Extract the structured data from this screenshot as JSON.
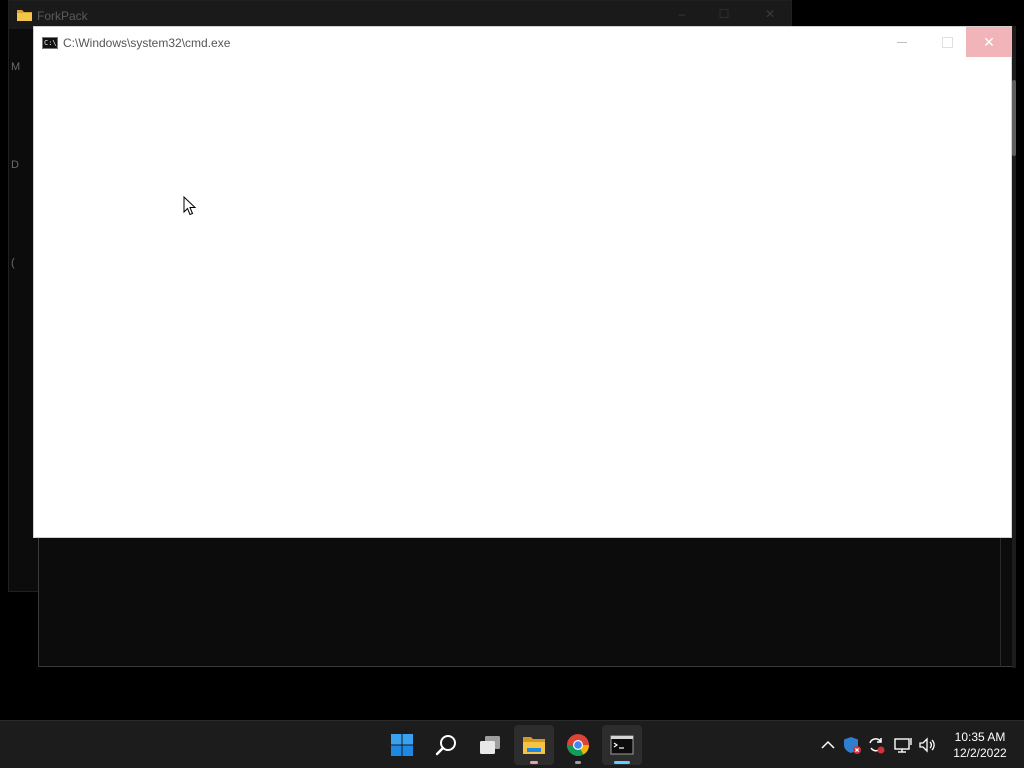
{
  "explorer_window": {
    "title": "ForkPack",
    "side_letters": [
      "M",
      "D",
      "("
    ]
  },
  "cmd_window": {
    "title": "C:\\Windows\\system32\\cmd.exe",
    "icon_label": "C:\\_",
    "close_glyph": "✕"
  },
  "taskbar": {
    "apps": [
      {
        "name": "Start",
        "icon": "windows-logo-icon"
      },
      {
        "name": "Search",
        "icon": "search-icon"
      },
      {
        "name": "Task View",
        "icon": "task-view-icon"
      },
      {
        "name": "File Explorer",
        "icon": "folder-icon"
      },
      {
        "name": "Google Chrome",
        "icon": "chrome-icon"
      },
      {
        "name": "Command Prompt",
        "icon": "terminal-icon"
      }
    ],
    "tray": {
      "chevron_icon": "chevron-up-icon",
      "icons": [
        "defender-icon",
        "sync-icon",
        "network-icon",
        "volume-icon"
      ]
    },
    "clock": {
      "time": "10:35 AM",
      "date": "12/2/2022"
    }
  },
  "colors": {
    "close_hover": "#f1b5b9",
    "taskbar": "#1c1c1c",
    "accent_indicator": "#60cdff",
    "folder_indicator": "#e8a1a4"
  }
}
